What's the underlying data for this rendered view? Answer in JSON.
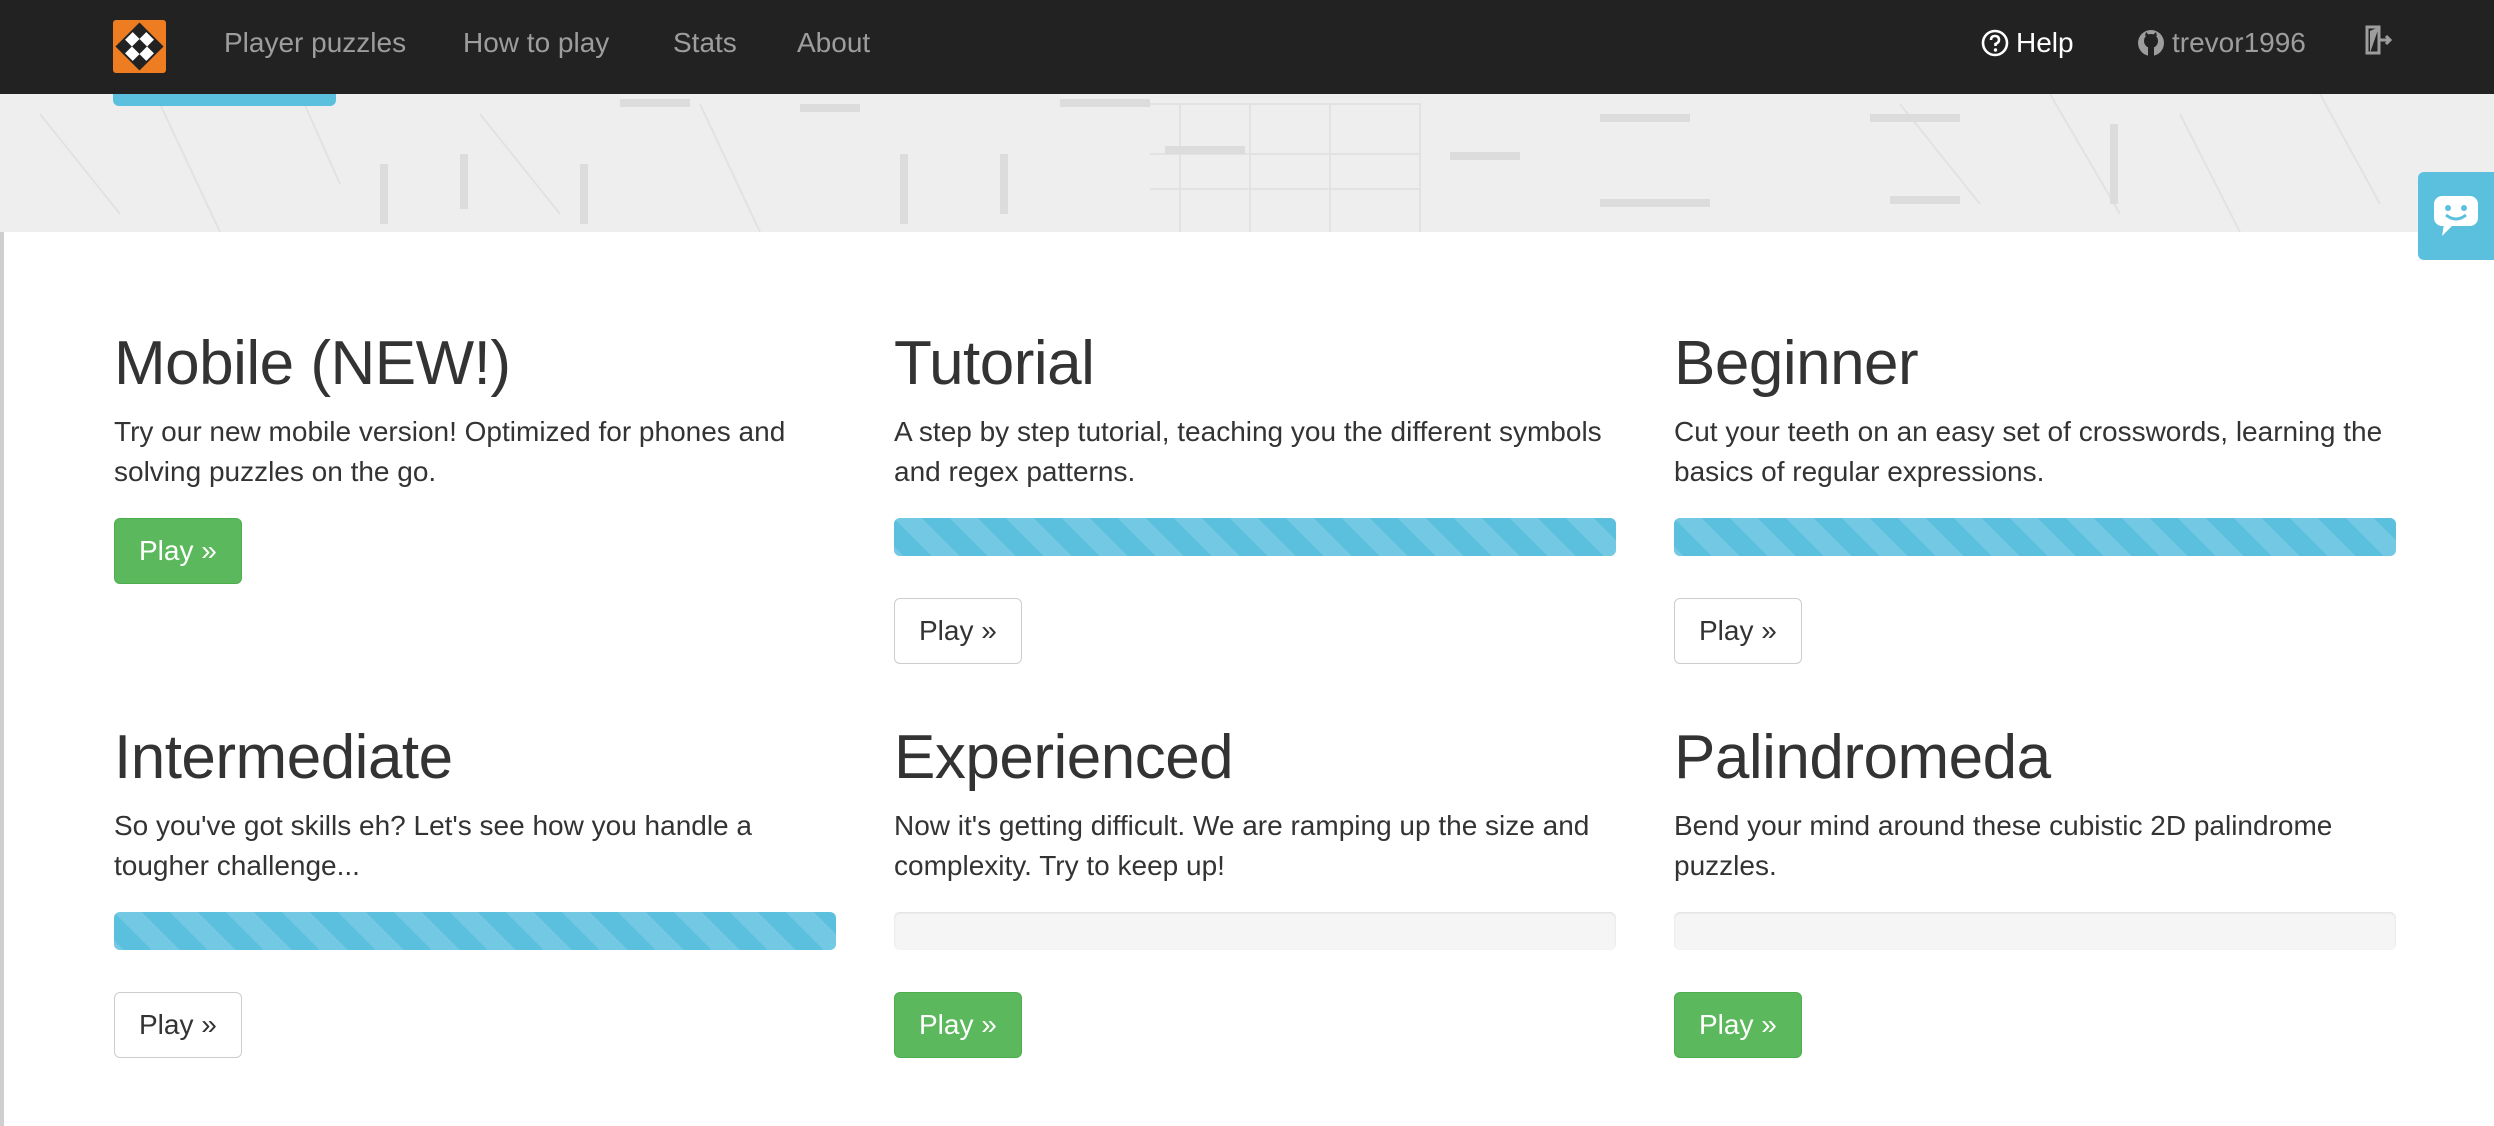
{
  "navbar": {
    "brand_icon": "regex-crossword-logo",
    "links": [
      {
        "label": "Player puzzles"
      },
      {
        "label": "How to play"
      },
      {
        "label": "Stats"
      },
      {
        "label": "About"
      }
    ],
    "help_label": "Help",
    "user_label": "trevor1996",
    "logout_icon": "sign-out-icon"
  },
  "colors": {
    "navbar_bg": "#222222",
    "accent_orange": "#ee7d22",
    "success": "#5cb85c",
    "info": "#5bc0de"
  },
  "feedback_icon": "chat-icon",
  "sections": [
    {
      "title": "Mobile (NEW!)",
      "description": "Try our new mobile version! Optimized for phones and solving puzzles on the go.",
      "progress": null,
      "button_label": "Play »",
      "button_style": "success"
    },
    {
      "title": "Tutorial",
      "description": "A step by step tutorial, teaching you the different symbols and regex patterns.",
      "progress": 1.0,
      "button_label": "Play »",
      "button_style": "default"
    },
    {
      "title": "Beginner",
      "description": "Cut your teeth on an easy set of crosswords, learning the basics of regular expressions.",
      "progress": 1.0,
      "button_label": "Play »",
      "button_style": "default"
    },
    {
      "title": "Intermediate",
      "description": "So you've got skills eh? Let's see how you handle a tougher challenge...",
      "progress": 1.0,
      "button_label": "Play »",
      "button_style": "default"
    },
    {
      "title": "Experienced",
      "description": "Now it's getting difficult. We are ramping up the size and complexity. Try to keep up!",
      "progress": 0.0,
      "button_label": "Play »",
      "button_style": "success"
    },
    {
      "title": "Palindromeda",
      "description": "Bend your mind around these cubistic 2D palindrome puzzles.",
      "progress": 0.0,
      "button_label": "Play »",
      "button_style": "success"
    }
  ]
}
